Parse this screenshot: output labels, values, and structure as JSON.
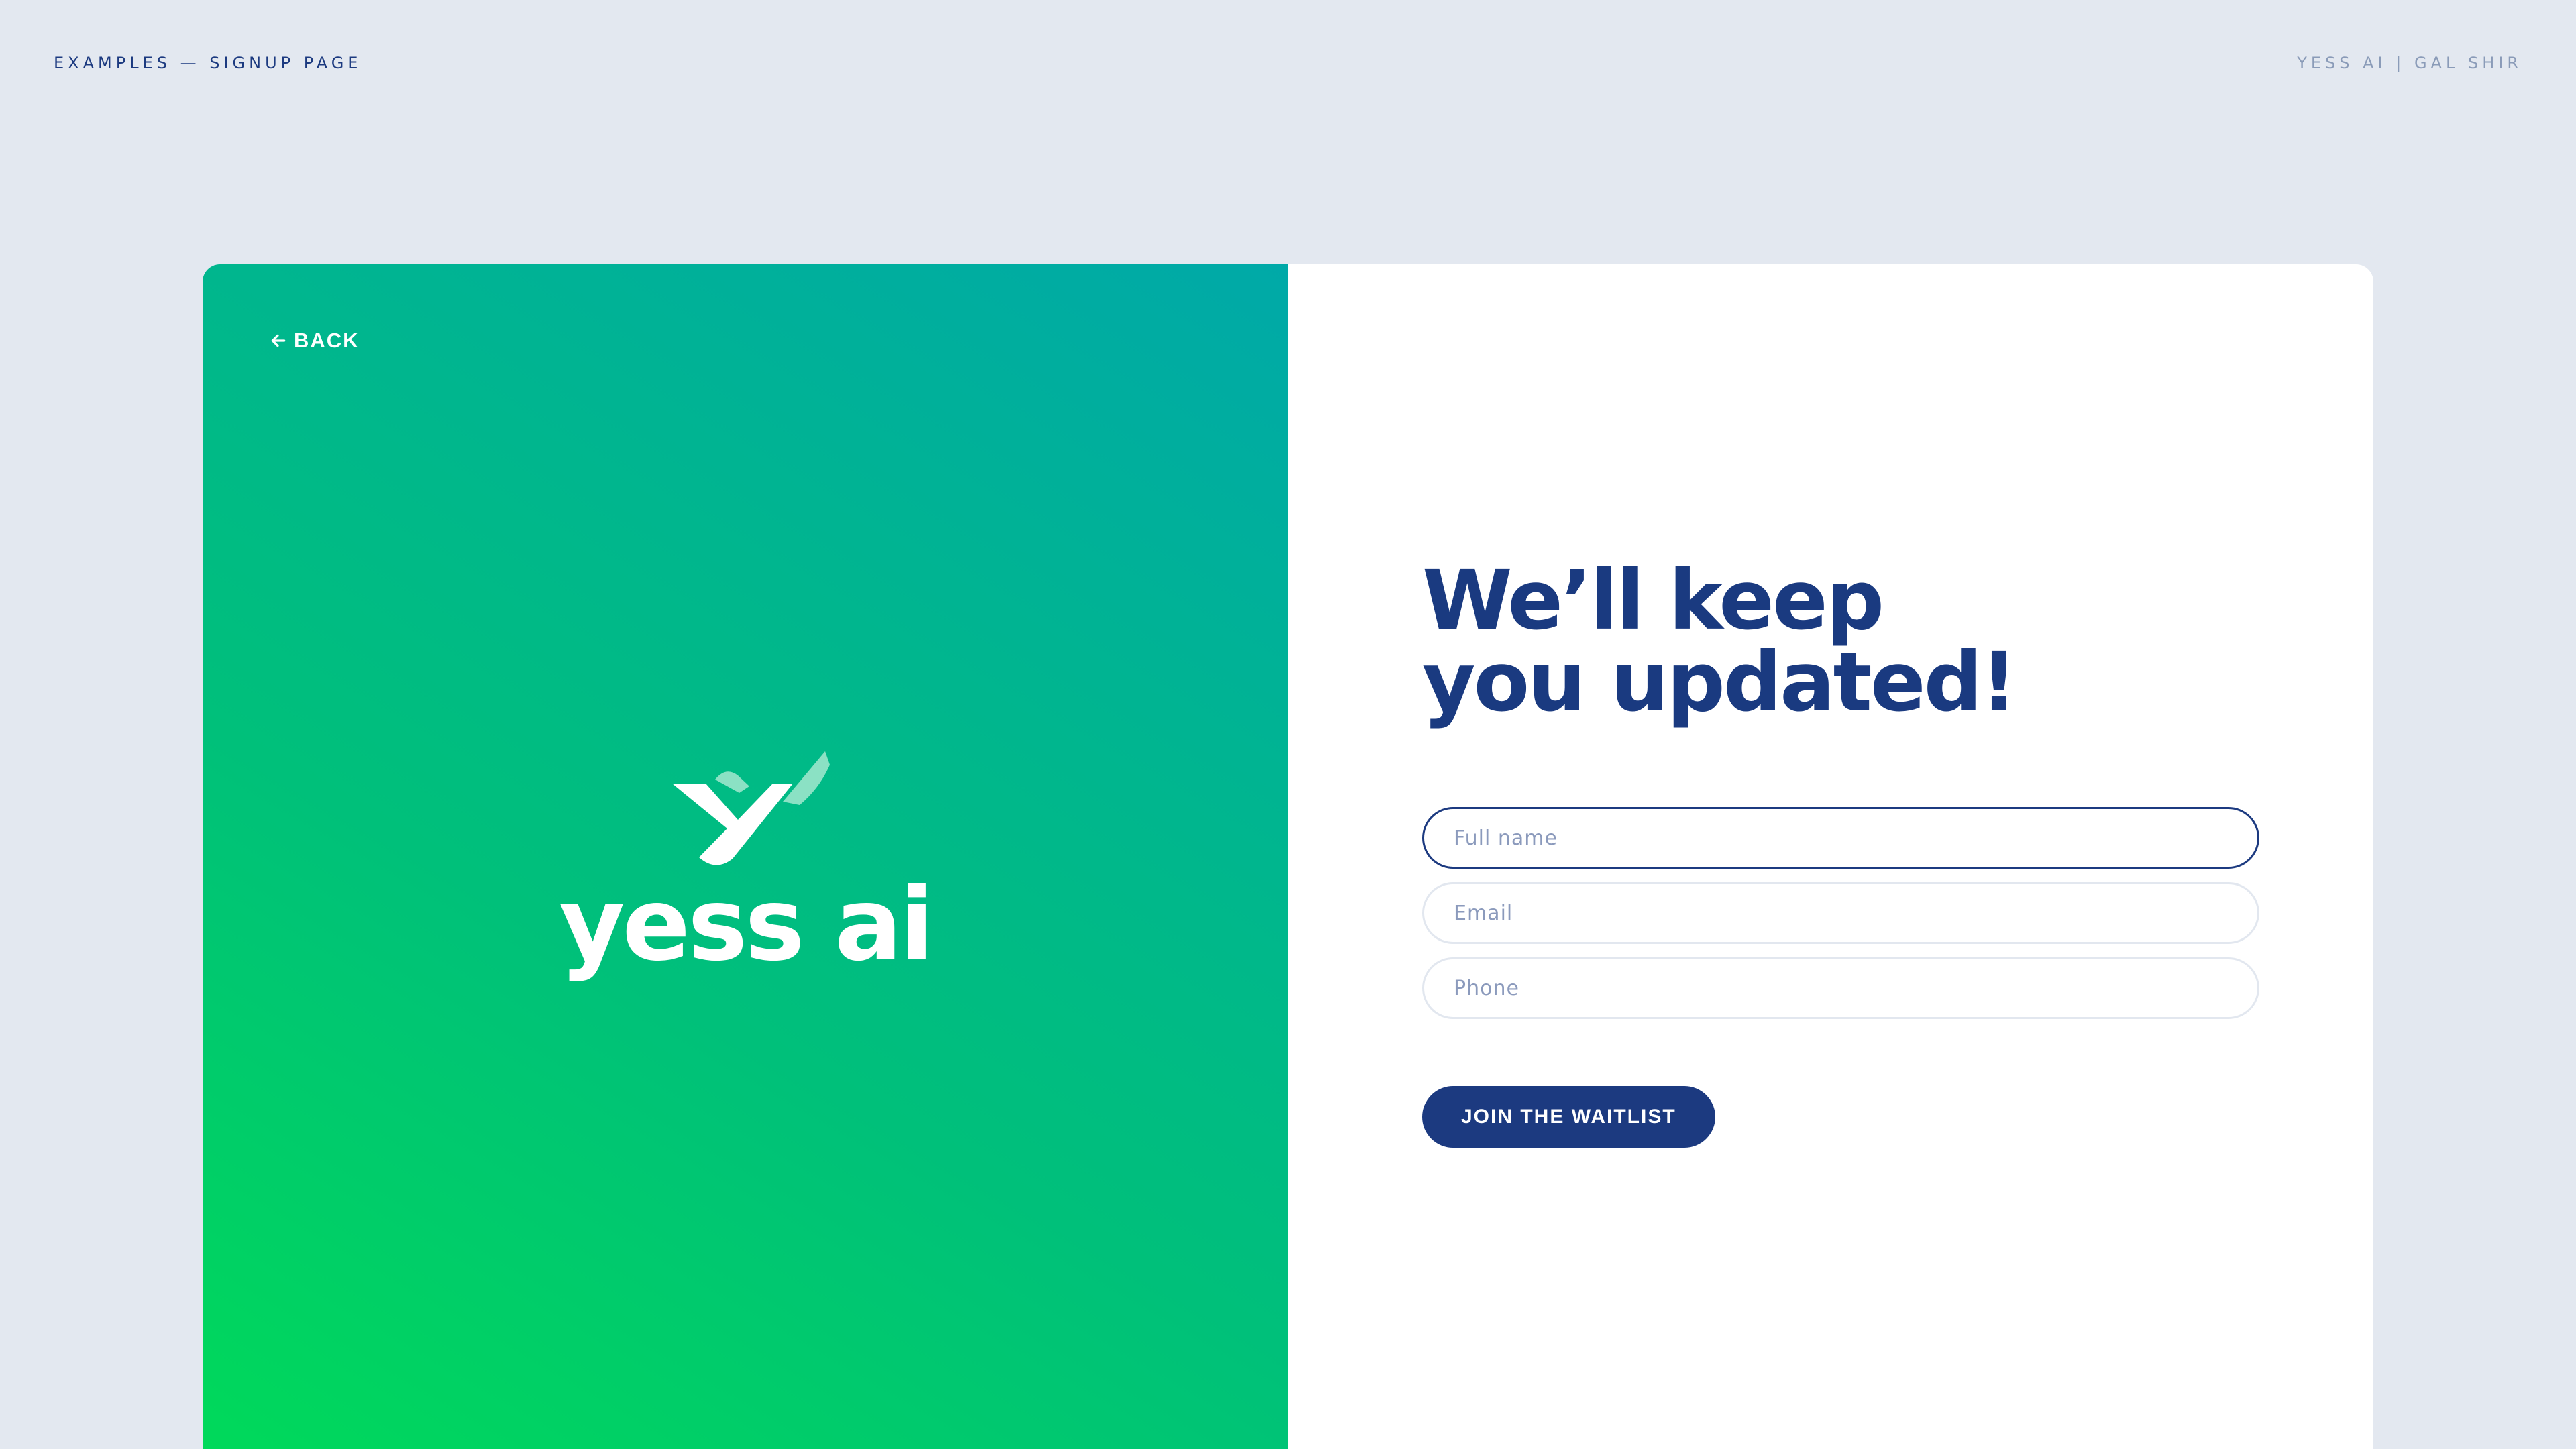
{
  "header": {
    "left_label": "EXAMPLES — SIGNUP PAGE",
    "right_label": "YESS AI | GAL SHIR"
  },
  "hero": {
    "back_label": "BACK",
    "brand_name": "yess ai",
    "gradient_colors": [
      "#00d95a",
      "#00a9a8"
    ]
  },
  "form": {
    "headline_line1": "We’ll keep",
    "headline_line2": "you updated!",
    "fields": [
      {
        "placeholder": "Full name",
        "value": "",
        "focused": true
      },
      {
        "placeholder": "Email",
        "value": ""
      },
      {
        "placeholder": "Phone",
        "value": ""
      }
    ],
    "submit_label": "JOIN THE WAITLIST"
  },
  "colors": {
    "page_bg": "#e3e8f0",
    "primary_navy": "#1c3a80",
    "muted_text": "#8a9bb8"
  }
}
